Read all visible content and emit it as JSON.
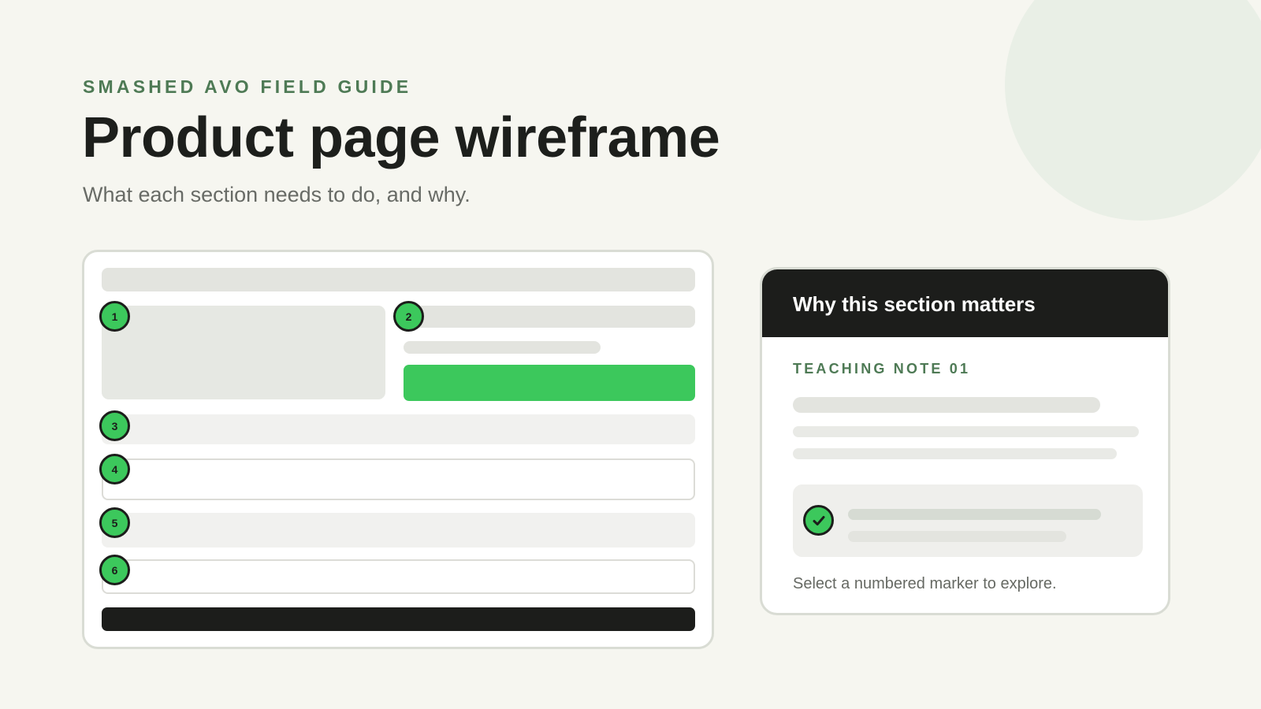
{
  "header": {
    "eyebrow": "SMASHED AVO FIELD GUIDE",
    "title": "Product page wireframe",
    "subtitle": "What each section needs to do, and why."
  },
  "wireframe": {
    "markers": [
      {
        "id": "1",
        "label": "1"
      },
      {
        "id": "2",
        "label": "2"
      },
      {
        "id": "3",
        "label": "3"
      },
      {
        "id": "4",
        "label": "4"
      },
      {
        "id": "5",
        "label": "5"
      },
      {
        "id": "6",
        "label": "6"
      }
    ]
  },
  "info_card": {
    "title": "Why this section matters",
    "note_label": "TEACHING NOTE 01",
    "check_icon": "check-circle-icon",
    "hint": "Select a numbered marker to explore."
  },
  "colors": {
    "accent": "#3cc85c",
    "dark": "#1c1d1b",
    "eyebrow_green": "#4e7a55",
    "background": "#f6f6f0"
  }
}
